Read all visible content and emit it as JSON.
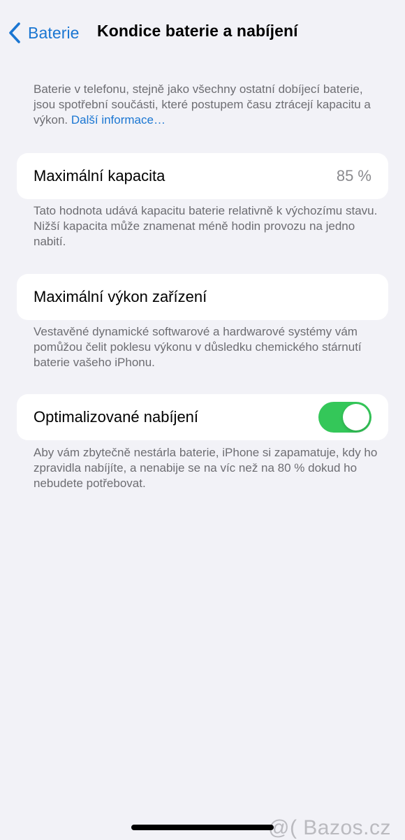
{
  "nav": {
    "back_label": "Baterie",
    "title": "Kondice baterie a nabíjení"
  },
  "intro": {
    "text": "Baterie v telefonu, stejně jako všechny ostatní dobíjecí baterie, jsou spotřební součásti, které postupem času ztrácejí kapacitu a výkon.",
    "link": "Další informace…"
  },
  "max_capacity": {
    "label": "Maximální kapacita",
    "value": "85 %",
    "footnote": "Tato hodnota udává kapacitu baterie relativně k výchozímu stavu. Nižší kapacita může znamenat méně hodin provozu na jedno nabití."
  },
  "peak_performance": {
    "label": "Maximální výkon zařízení",
    "footnote": "Vestavěné dynamické softwarové a hardwarové systémy vám pomůžou čelit poklesu výkonu v důsledku chemického stárnutí baterie vašeho iPhonu."
  },
  "optimized_charging": {
    "label": "Optimalizované nabíjení",
    "enabled": true,
    "footnote": "Aby vám zbytečně nestárla baterie, iPhone si zapamatuje, kdy ho zpravidla nabíjíte, a nenabije se na víc než na 80 % dokud ho nebudete potřebovat."
  },
  "watermark": "@( Bazos.cz",
  "colors": {
    "background": "#f2f2f7",
    "accent": "#1a76d2",
    "toggle_on": "#34c759",
    "secondary_text": "#6d6d72"
  },
  "icons": {
    "back": "chevron-left-icon"
  }
}
